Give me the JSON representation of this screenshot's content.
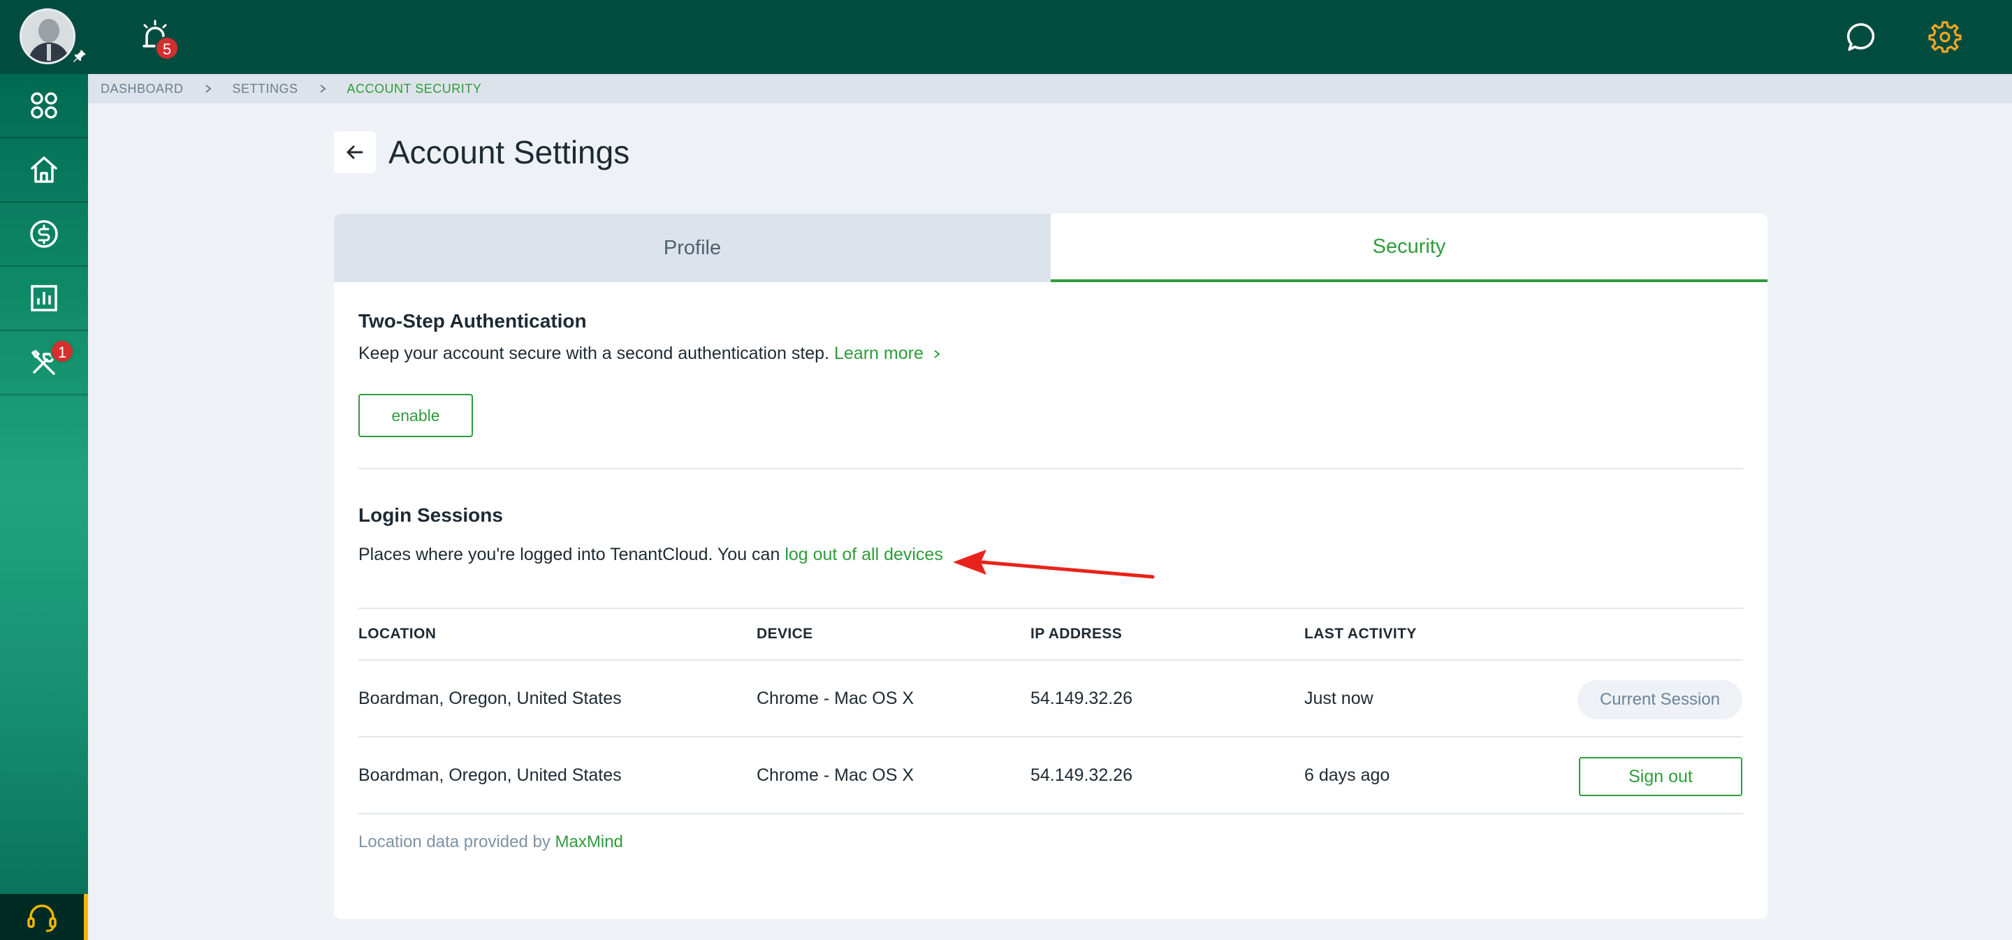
{
  "topbar": {
    "notifications_count": "5",
    "colors": {
      "background": "#004d40",
      "gear": "#f5a623",
      "badge": "#d32f2f"
    }
  },
  "sidebar": {
    "items": [
      {
        "icon": "apps-grid-icon"
      },
      {
        "icon": "home-icon"
      },
      {
        "icon": "dollar-icon"
      },
      {
        "icon": "reports-chart-icon"
      },
      {
        "icon": "tools-icon",
        "badge": "1"
      }
    ],
    "support_icon": "headset-icon"
  },
  "breadcrumb": {
    "items": [
      "DASHBOARD",
      "SETTINGS",
      "ACCOUNT SECURITY"
    ]
  },
  "page": {
    "title": "Account Settings"
  },
  "tabs": {
    "profile": "Profile",
    "security": "Security",
    "active": "Security"
  },
  "two_step": {
    "title": "Two-Step Authentication",
    "description": "Keep your account secure with a second authentication step.",
    "learn_more": "Learn more",
    "enable_label": "enable"
  },
  "sessions": {
    "title": "Login Sessions",
    "description": "Places where you're logged into TenantCloud. You can",
    "logout_all_link": "log out of all devices",
    "columns": [
      "LOCATION",
      "DEVICE",
      "IP ADDRESS",
      "LAST ACTIVITY"
    ],
    "rows": [
      {
        "location": "Boardman, Oregon, United States",
        "device": "Chrome - Mac OS X",
        "ip": "54.149.32.26",
        "last_activity": "Just now",
        "action": "Current Session"
      },
      {
        "location": "Boardman, Oregon, United States",
        "device": "Chrome - Mac OS X",
        "ip": "54.149.32.26",
        "last_activity": "6 days ago",
        "action": "Sign out"
      }
    ],
    "footnote_prefix": "Location data provided by",
    "footnote_link": "MaxMind"
  },
  "colors": {
    "accent": "#2e9c3a",
    "annotation_arrow": "#e8231b"
  }
}
